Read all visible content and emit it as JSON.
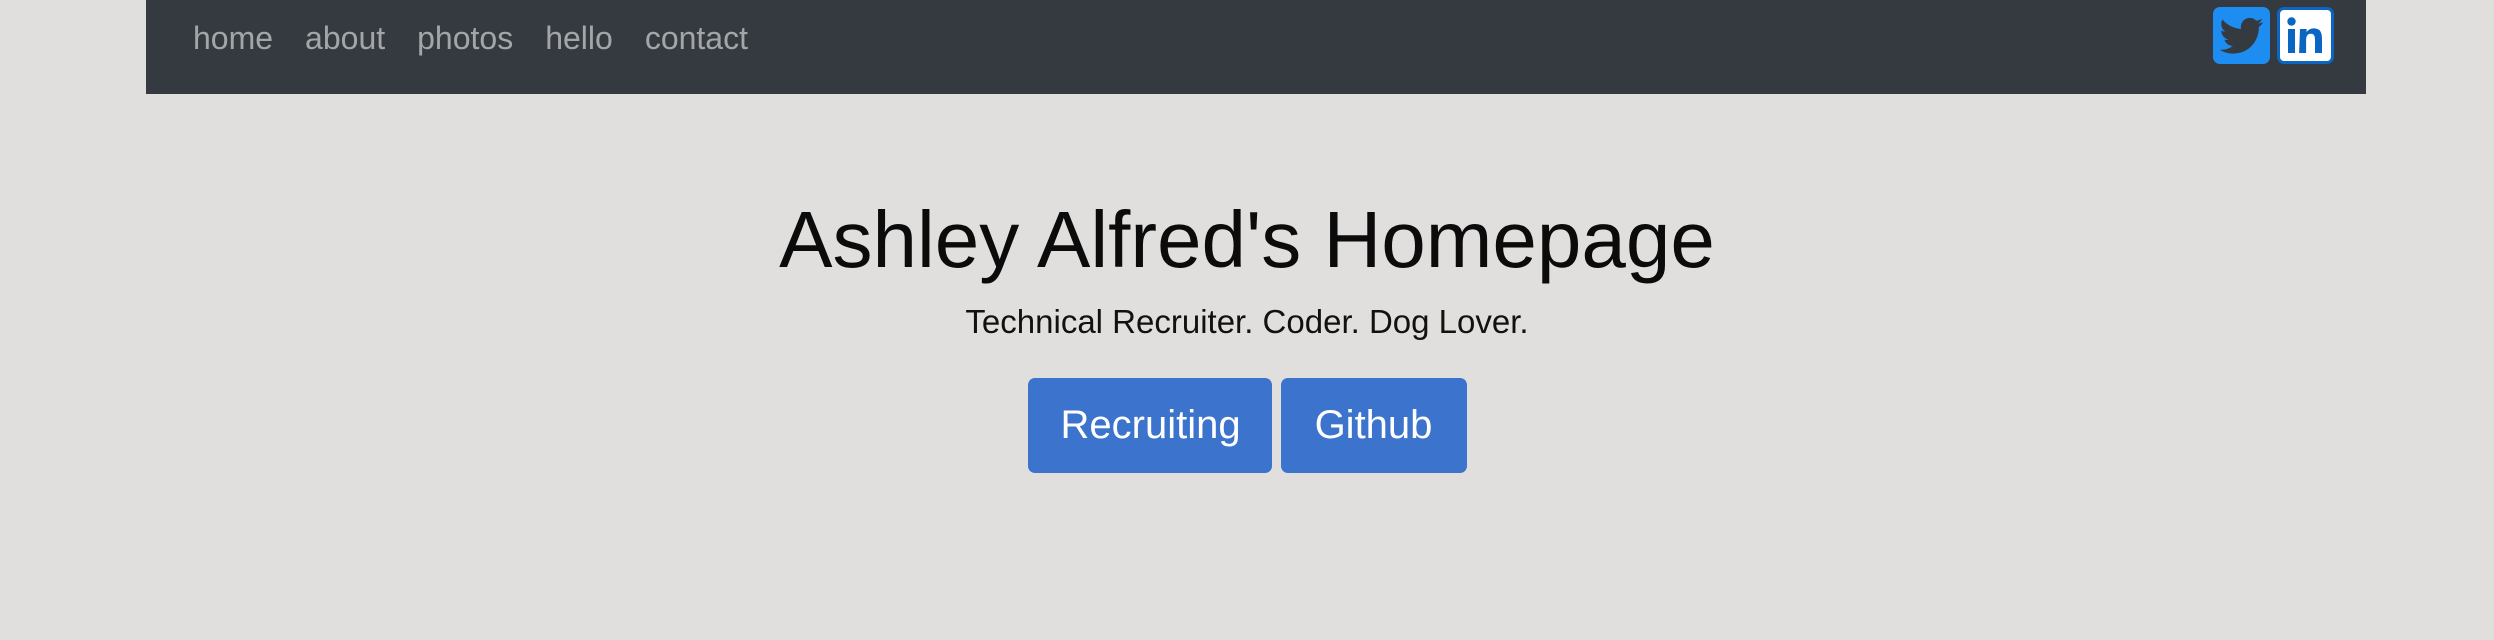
{
  "nav": {
    "links": [
      "home",
      "about",
      "photos",
      "hello",
      "contact"
    ]
  },
  "social": {
    "twitter_icon": "twitter-icon",
    "linkedin_icon": "linkedin-icon",
    "linkedin_text": "in"
  },
  "hero": {
    "title": "Ashley Alfred's Homepage",
    "subtitle": "Technical Recruiter. Coder. Dog Lover.",
    "buttons": [
      "Recruiting",
      "Github"
    ]
  },
  "colors": {
    "background": "#e1dfde",
    "navbar": "#343a40",
    "button": "#3b73cd",
    "twitter": "#1d8df2",
    "linkedin": "#0a66c2"
  }
}
